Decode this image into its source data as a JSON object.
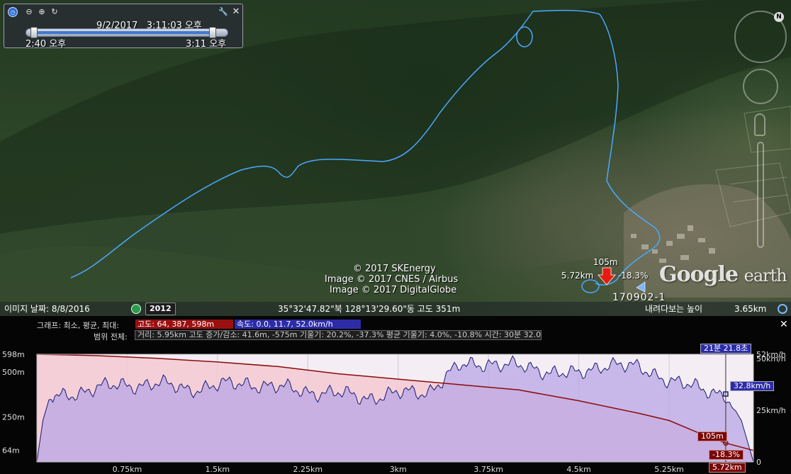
{
  "time_slider": {
    "current_time": "9/2/2017   3:11:03 오후",
    "start_label": "2:40 오후",
    "end_label": "3:11 오후",
    "position_fraction": 1.0
  },
  "map": {
    "copyrights": [
      "© 2017 SKEnergy",
      "Image © 2017 CNES / Airbus",
      "Image © 2017 DigitalGlobe"
    ],
    "track_marker": {
      "elevation": "105m",
      "distance": "5.72km",
      "slope": "-18.3%"
    },
    "placemark_name": "170902-1",
    "brand": {
      "google": "Google",
      "earth": "earth"
    },
    "colors": {
      "track": "#4aa8ff",
      "marker": "#e41c12"
    }
  },
  "status_bar": {
    "image_date": "이미지 날짜: 8/8/2016",
    "history_year": "2012",
    "coordinates": "35°32'47.82\"북 128°13'29.60\"동 고도   351m",
    "eye_alt_label": "내려다보는 높이",
    "eye_alt_value": "3.65km"
  },
  "profile": {
    "graph_label": "그래프: 최소, 평균, 최대:",
    "range_label": "범위 전체:",
    "elevation_stats": "고도: 64, 387, 598m",
    "speed_stats": "속도: 0.0, 11.7, 52.0km/h",
    "range_summary": "거리: 5.95km 고도 증가/감소: 41.6m, -575m 기울기: 20.2%, -37.3% 평균 기울기: 4.0%, -10.8% 시간: 30분 32.0초",
    "cursor_time": "21분 21.8초",
    "cursor_speed": "32.8km/h",
    "cursor_elevation": "105m",
    "cursor_slope": "-18.3%",
    "cursor_distance": "5.72km",
    "colors": {
      "elevation": "#8b0a0a",
      "speed": "#1a1a6e",
      "elevation_fill": "#f3c9d2",
      "speed_fill": "#b9a6e6"
    }
  },
  "chart_data": {
    "type": "line",
    "title": "",
    "xlabel": "",
    "ylabel": "",
    "x_tick_labels": [
      "0.75km",
      "1.5km",
      "2.25km",
      "3km",
      "3.75km",
      "4.5km",
      "5.25km"
    ],
    "x_ticks": [
      0.75,
      1.5,
      2.25,
      3.0,
      3.75,
      4.5,
      5.25
    ],
    "xlim": [
      0,
      5.95
    ],
    "left_axis": {
      "tick_labels": [
        "598m",
        "500m",
        "250m",
        "64m"
      ],
      "ticks": [
        598,
        500,
        250,
        64
      ],
      "ylim": [
        0,
        598
      ]
    },
    "right_axis": {
      "tick_labels": [
        "52km/h",
        "50km/h",
        "25km/h",
        "0"
      ],
      "ticks": [
        52,
        50,
        25,
        0
      ],
      "ylim": [
        0,
        52
      ]
    },
    "cursor_x": 5.72,
    "grid": true,
    "series": [
      {
        "name": "고도",
        "axis": "left",
        "x": [
          0,
          0.5,
          1.0,
          1.5,
          2.0,
          2.5,
          3.0,
          3.5,
          4.0,
          4.5,
          5.0,
          5.25,
          5.5,
          5.72,
          5.95
        ],
        "y": [
          598,
          590,
          575,
          555,
          530,
          490,
          460,
          430,
          400,
          340,
          270,
          230,
          160,
          105,
          64
        ]
      },
      {
        "name": "속도",
        "axis": "right",
        "x": [
          0,
          0.05,
          0.1,
          0.3,
          0.5,
          0.75,
          1.0,
          1.25,
          1.5,
          1.75,
          2.0,
          2.25,
          2.5,
          2.75,
          3.0,
          3.25,
          3.5,
          3.75,
          4.0,
          4.25,
          4.5,
          4.75,
          5.0,
          5.25,
          5.5,
          5.72,
          5.85,
          5.95
        ],
        "y": [
          0,
          20,
          30,
          33,
          36,
          37,
          38,
          35,
          37,
          38,
          36,
          34,
          33,
          31,
          33,
          34,
          46,
          48,
          46,
          44,
          42,
          48,
          45,
          40,
          35,
          32.8,
          20,
          0
        ]
      }
    ]
  }
}
